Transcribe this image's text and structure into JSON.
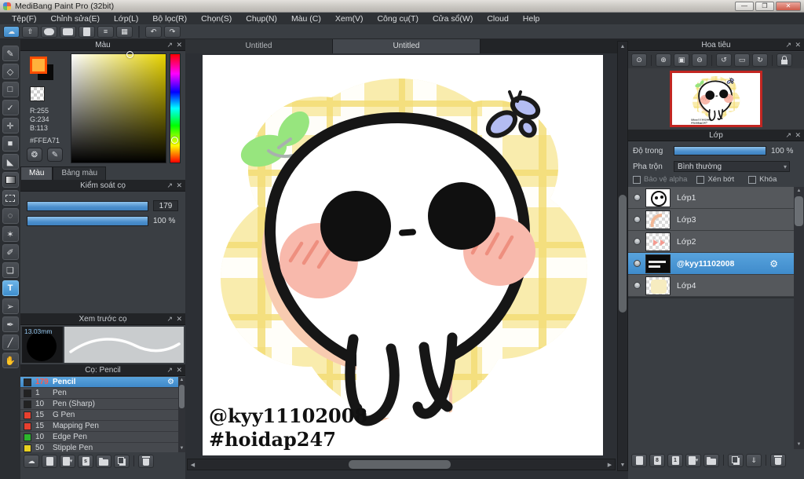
{
  "window": {
    "title": "MediBang Paint Pro (32bit)"
  },
  "window_controls": {
    "min": "—",
    "max": "❐",
    "close": "✕"
  },
  "menu": {
    "items": [
      "Tệp(F)",
      "Chỉnh sửa(E)",
      "Lớp(L)",
      "Bộ lọc(R)",
      "Chọn(S)",
      "Chụp(N)",
      "Màu (C)",
      "Xem(V)",
      "Công cụ(T)",
      "Cửa sổ(W)",
      "Cloud",
      "Help"
    ]
  },
  "main_toolbar": {
    "cloud": "☁",
    "export": "⇧",
    "list": "≡",
    "grid": "▦",
    "undo": "↶",
    "redo": "↷"
  },
  "tools": {
    "glyphs": [
      "✎",
      "◇",
      "□",
      "✓",
      "✛",
      "■",
      "◣",
      "",
      "",
      "◌",
      "✶",
      "✐",
      "❏",
      "T",
      "➢",
      "✒",
      "╱",
      "✋"
    ]
  },
  "color_panel": {
    "title": "Màu",
    "r": "R:255",
    "g": "G:234",
    "b": "B:113",
    "hex": "#FFEA71",
    "fg_color": "#ffb13b",
    "tab_color": "Màu",
    "tab_palette": "Bảng màu",
    "palette_btn1": "❂",
    "palette_btn2": "✎"
  },
  "brush_control": {
    "title": "Kiểm soát cọ",
    "size_value": "179",
    "opacity_value": "100 %"
  },
  "brush_preview": {
    "title": "Xem trước cọ",
    "size_label": "13.03mm"
  },
  "brush_panel": {
    "title": "Cọ: Pencil",
    "brushes": [
      {
        "size": "179",
        "name": "Pencil",
        "swatch": "#2a2a2a",
        "selected": true
      },
      {
        "size": "1",
        "name": "Pen",
        "swatch": "#222222"
      },
      {
        "size": "10",
        "name": "Pen (Sharp)",
        "swatch": "#222222"
      },
      {
        "size": "15",
        "name": "G Pen",
        "swatch": "#e8402f"
      },
      {
        "size": "15",
        "name": "Mapping Pen",
        "swatch": "#e8402f"
      },
      {
        "size": "10",
        "name": "Edge Pen",
        "swatch": "#2db52d"
      },
      {
        "size": "50",
        "name": "Stipple Pen",
        "swatch": "#e8d020"
      }
    ]
  },
  "canvas": {
    "tab1": "Untitled",
    "tab2": "Untitled",
    "watermark_line1": "@kyy11102008",
    "watermark_line2": "#hoidap247"
  },
  "navigator": {
    "title": "Hoa tiêu",
    "glyphs": [
      "⊙",
      "⊕",
      "▣",
      "⊖",
      "↺",
      "▭",
      "↻"
    ]
  },
  "layers": {
    "title": "Lớp",
    "opacity_label": "Độ trong",
    "opacity_value": "100 %",
    "blend_label": "Pha trộn",
    "blend_value": "Bình thường",
    "cb_alpha": "Bảo vệ alpha",
    "cb_clip": "Xén bớt",
    "cb_lock": "Khóa",
    "items": [
      {
        "name": "Lớp1"
      },
      {
        "name": "Lớp3"
      },
      {
        "name": "Lớp2"
      },
      {
        "name": "@kyy11102008",
        "selected": true
      },
      {
        "name": "Lớp4"
      }
    ],
    "doc8": "8",
    "doc1": "1"
  },
  "icons": {
    "gear": "⚙",
    "caret": "▾",
    "popout": "↗",
    "close": "✕",
    "up": "▲",
    "down": "▼",
    "left": "◀",
    "right": "▶",
    "merge": "⇓"
  },
  "accent_colors": {
    "selection_blue": "#4a96d8",
    "slider_blue": "#4a8ecc",
    "brush_size_red": "#ff5a4e"
  }
}
